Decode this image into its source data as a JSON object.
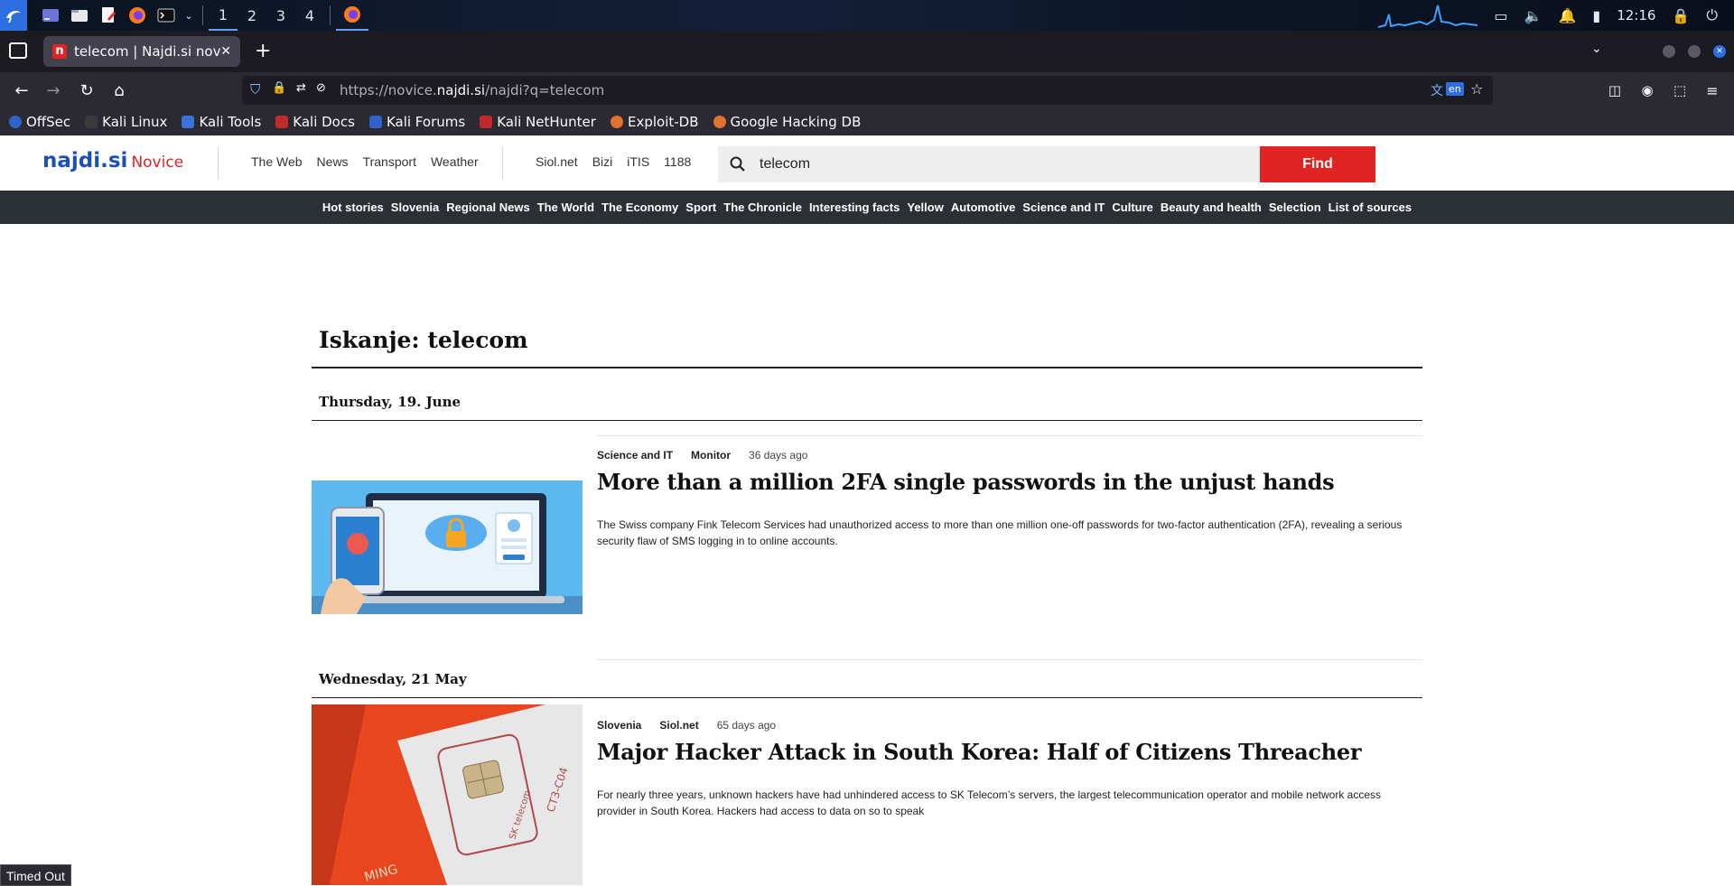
{
  "taskbar": {
    "workspaces": [
      "1",
      "2",
      "3",
      "4"
    ],
    "clock": "12:16",
    "apps": [
      "kali-menu-icon",
      "desktop-icon",
      "files-icon",
      "text-editor-icon",
      "firefox-icon",
      "terminal-icon"
    ]
  },
  "browser": {
    "tab_title": "telecom | Najdi.si novice",
    "url_prefix": "https://novice.",
    "url_domain": "najdi.si",
    "url_suffix": "/najdi?q=telecom",
    "translate_badge": "en"
  },
  "bookmarks": [
    {
      "label": "OffSec",
      "color": "#2f63c8"
    },
    {
      "label": "Kali Linux",
      "color": "#3a3a3a"
    },
    {
      "label": "Kali Tools",
      "color": "#3773d9"
    },
    {
      "label": "Kali Docs",
      "color": "#c02a2a"
    },
    {
      "label": "Kali Forums",
      "color": "#2f63c8"
    },
    {
      "label": "Kali NetHunter",
      "color": "#c02a2a"
    },
    {
      "label": "Exploit-DB",
      "color": "#e0732e"
    },
    {
      "label": "Google Hacking DB",
      "color": "#e0732e"
    }
  ],
  "site": {
    "logo": "najdi.si",
    "logo_sub": "Novice",
    "primary_links": [
      "The Web",
      "News",
      "Transport",
      "Weather"
    ],
    "secondary_links": [
      "Siol.net",
      "Bizi",
      "iTIS",
      "1188"
    ],
    "search_value": "telecom",
    "find_label": "Find",
    "categories": [
      "Hot stories",
      "Slovenia",
      "Regional News",
      "The World",
      "The Economy",
      "Sport",
      "The Chronicle",
      "Interesting facts",
      "Yellow",
      "Automotive",
      "Science and IT",
      "Culture",
      "Beauty and health",
      "Selection",
      "List of sources"
    ]
  },
  "results": {
    "title": "Iskanje: telecom",
    "groups": [
      {
        "date": "Thursday, 19. June",
        "article": {
          "category": "Science and IT",
          "source": "Monitor",
          "age": "36 days ago",
          "headline": "More than a million 2FA single passwords in the unjust hands",
          "summary": "The Swiss company Fink Telecom Services had unauthorized access to more than one million one-off passwords for two-factor authentication (2FA), revealing a serious security flaw of SMS logging in to online accounts."
        }
      },
      {
        "date": "Wednesday, 21 May",
        "article": {
          "category": "Slovenia",
          "source": "Siol.net",
          "age": "65 days ago",
          "headline": "Major Hacker Attack in South Korea: Half of Citizens Threacher",
          "summary": "For nearly three years, unknown hackers have had unhindered access to SK Telecom’s servers, the largest telecommunication operator and mobile network access provider in South Korea. Hackers had access to data on so to speak"
        }
      }
    ]
  },
  "status": "Timed Out"
}
